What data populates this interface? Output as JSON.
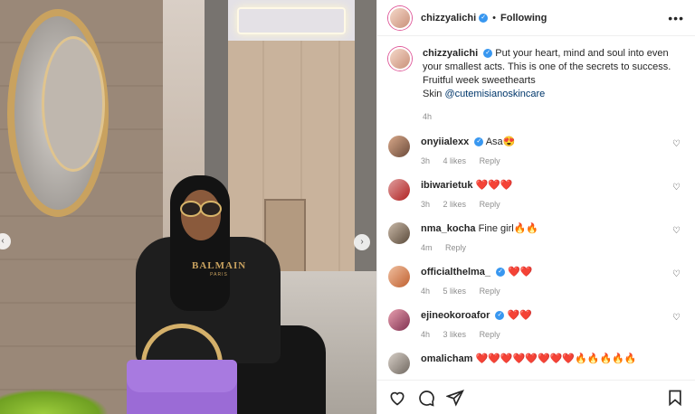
{
  "post": {
    "username": "chizzyalichi",
    "follow_status": "Following",
    "caption": {
      "username": "chizzyalichi",
      "text": "Put your heart, mind and soul into even your smallest acts. This is one of the secrets to success. Fruitful week sweethearts",
      "skin_prefix": "Skin",
      "mention": "@cutemisianoskincare",
      "time": "4h"
    },
    "shirt_text": "BALMAIN",
    "shirt_subtext": "PARIS"
  },
  "comments": [
    {
      "username": "onyiialexx",
      "verified": true,
      "text": "Asa😍",
      "time": "3h",
      "likes": "4 likes",
      "reply": "Reply"
    },
    {
      "username": "ibiwarietuk",
      "verified": false,
      "text": "❤️❤️❤️",
      "time": "3h",
      "likes": "2 likes",
      "reply": "Reply"
    },
    {
      "username": "nma_kocha",
      "verified": false,
      "text": "Fine girl🔥🔥",
      "time": "4m",
      "likes": "",
      "reply": "Reply"
    },
    {
      "username": "officialthelma_",
      "verified": true,
      "text": "❤️❤️",
      "time": "4h",
      "likes": "5 likes",
      "reply": "Reply"
    },
    {
      "username": "ejineokoroafor",
      "verified": true,
      "text": "❤️❤️",
      "time": "4h",
      "likes": "3 likes",
      "reply": "Reply"
    },
    {
      "username": "omalicham",
      "verified": false,
      "text": "❤️❤️❤️❤️❤️❤️❤️❤️🔥🔥🔥🔥🔥",
      "time": "",
      "likes": "",
      "reply": ""
    }
  ],
  "icons": {
    "heart": "heart-icon",
    "comment": "comment-icon",
    "share": "share-icon",
    "save": "bookmark-icon",
    "more": "more-icon",
    "verified": "verified-icon"
  },
  "colors": {
    "verified": "#3897f0",
    "mention": "#00376b",
    "muted": "#8e8e8e",
    "bag": "#9b6bd6"
  }
}
